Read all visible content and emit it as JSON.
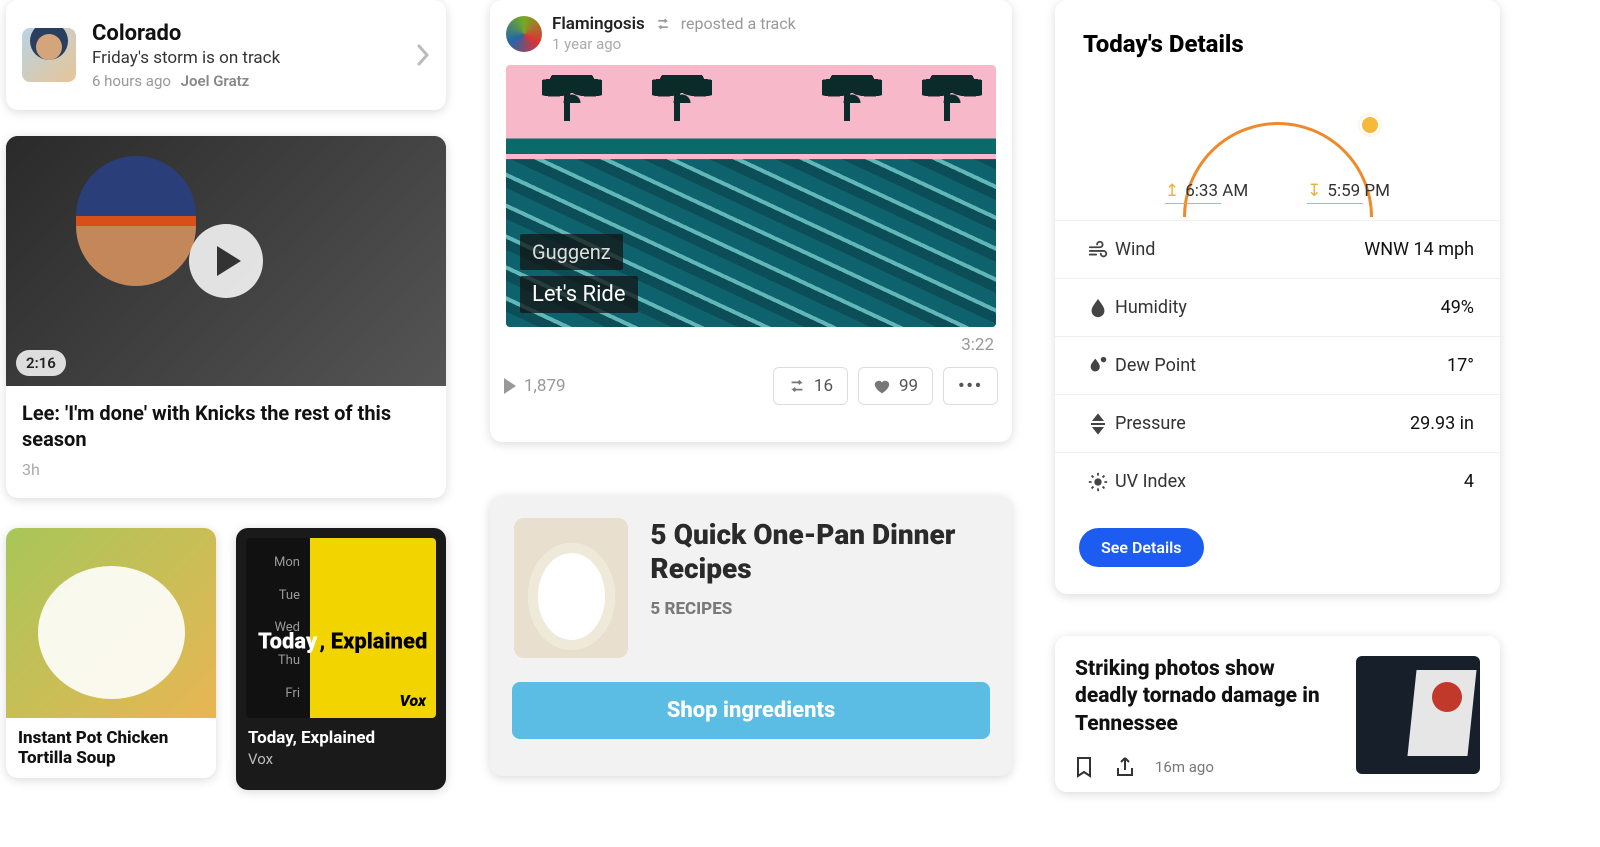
{
  "colorado": {
    "title": "Colorado",
    "subtitle": "Friday's storm is on track",
    "time": "6 hours ago",
    "author": "Joel Gratz"
  },
  "video": {
    "duration": "2:16",
    "headline": "Lee: 'I'm done' with Knicks the rest of this season",
    "time": "3h"
  },
  "soup": {
    "title": "Instant Pot Chicken Tortilla Soup"
  },
  "podcast": {
    "days": [
      "Mon",
      "Tue",
      "Wed",
      "Thu",
      "Fri"
    ],
    "line1": "Today",
    "line2": ", Explained",
    "brand": "Vox",
    "title": "Today, Explained",
    "source": "Vox"
  },
  "track": {
    "user": "Flamingosis",
    "action": "reposted a track",
    "when": "1 year ago",
    "artist": "Guggenz",
    "title": "Let's Ride",
    "duration": "3:22",
    "plays": "1,879",
    "reposts": "16",
    "likes": "99"
  },
  "recipes": {
    "title": "5 Quick One-Pan Dinner Recipes",
    "sub": "5 RECIPES",
    "cta": "Shop ingredients"
  },
  "weather": {
    "title": "Today's Details",
    "sunrise": "6:33 AM",
    "sunset": "5:59 PM",
    "rows": [
      {
        "k": "Wind",
        "v": "WNW 14 mph"
      },
      {
        "k": "Humidity",
        "v": "49%"
      },
      {
        "k": "Dew Point",
        "v": "17°"
      },
      {
        "k": "Pressure",
        "v": "29.93 in"
      },
      {
        "k": "UV Index",
        "v": "4"
      }
    ],
    "cta": "See Details"
  },
  "tornado": {
    "headline": "Striking photos show deadly tornado damage in Tennessee",
    "time": "16m ago"
  }
}
